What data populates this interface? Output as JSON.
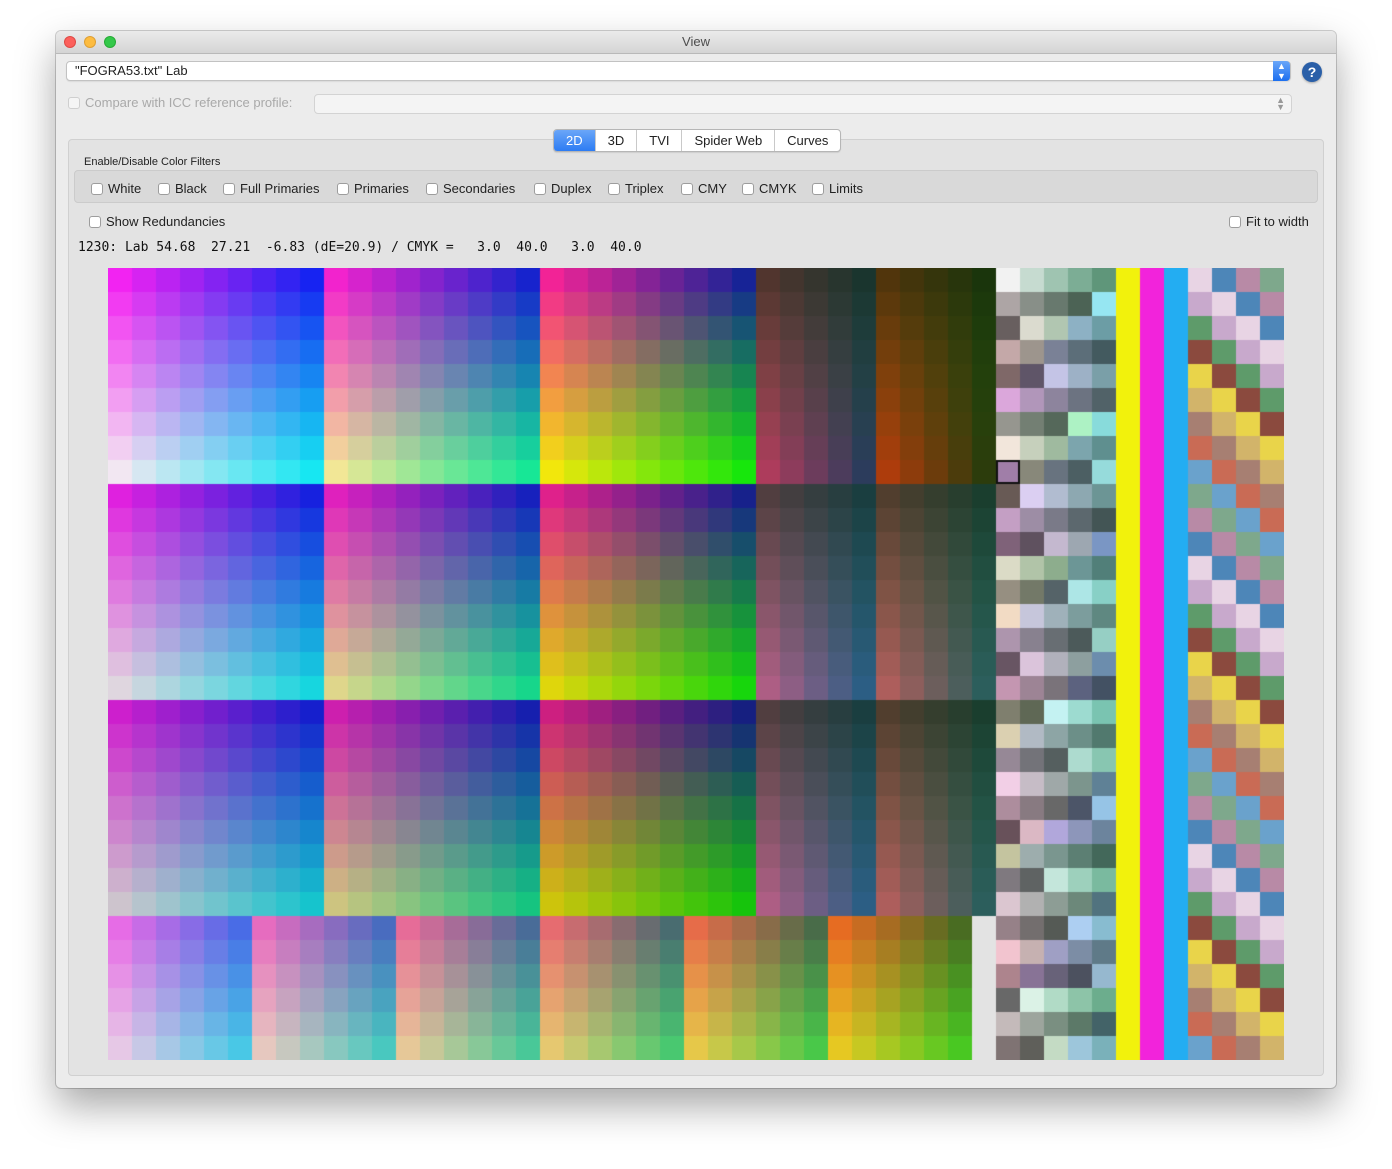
{
  "window": {
    "title": "View"
  },
  "profile": {
    "value": "\"FOGRA53.txt\" Lab"
  },
  "help": {
    "label": "?"
  },
  "compare": {
    "label": "Compare with ICC reference profile:",
    "value": ""
  },
  "tabs": [
    {
      "label": "2D",
      "active": true
    },
    {
      "label": "3D",
      "active": false
    },
    {
      "label": "TVI",
      "active": false
    },
    {
      "label": "Spider Web",
      "active": false
    },
    {
      "label": "Curves",
      "active": false
    }
  ],
  "filters": {
    "title": "Enable/Disable Color Filters",
    "items": [
      {
        "label": "White",
        "checked": false
      },
      {
        "label": "Black",
        "checked": false
      },
      {
        "label": "Full Primaries",
        "checked": false
      },
      {
        "label": "Primaries",
        "checked": false
      },
      {
        "label": "Secondaries",
        "checked": false
      },
      {
        "label": "Duplex",
        "checked": false
      },
      {
        "label": "Triplex",
        "checked": false
      },
      {
        "label": "CMY",
        "checked": false
      },
      {
        "label": "CMYK",
        "checked": false
      },
      {
        "label": "Limits",
        "checked": false
      }
    ]
  },
  "options": {
    "show_redundancies": {
      "label": "Show Redundancies",
      "checked": false
    },
    "fit_to_width": {
      "label": "Fit to width",
      "checked": false
    }
  },
  "readout": "1230: Lab 54.68  27.21  -6.83 (dE=20.9) / CMYK =   3.0  40.0   3.0  40.0",
  "patch_grid": {
    "columns": 49,
    "rows": 33,
    "selected_patch": 1230,
    "selected_color": "#a07ea8"
  }
}
